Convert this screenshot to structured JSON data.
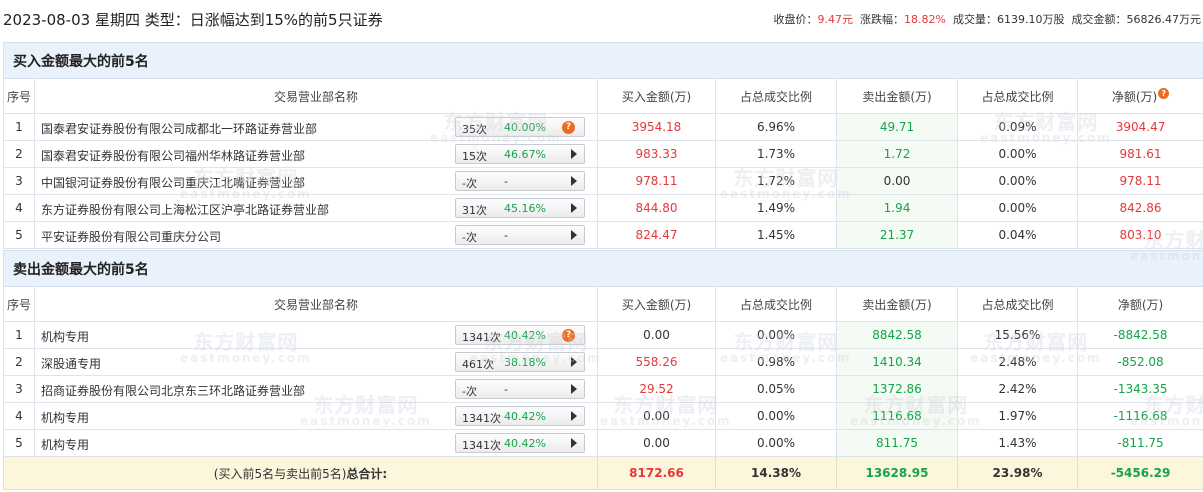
{
  "header": {
    "title": "2023-08-03 星期四 类型：日涨幅达到15%的前5只证券",
    "close_label": "收盘价：",
    "close_value": "9.47",
    "close_unit": "元",
    "change_label": "涨跌幅：",
    "change_value": "18.82%",
    "volume_label": "成交量：",
    "volume_value": "6139.10万股",
    "amount_label": "成交金额：",
    "amount_value": "56826.47万元"
  },
  "columns": {
    "seq": "序号",
    "dept": "交易营业部名称",
    "buy_amt": "买入金额(万)",
    "buy_ratio": "占总成交比例",
    "sell_amt": "卖出金额(万)",
    "sell_ratio": "占总成交比例",
    "net": "净额(万)"
  },
  "buy_section": {
    "title": "买入金额最大的前5名",
    "rows": [
      {
        "seq": "1",
        "name": "国泰君安证券股份有限公司成都北一环路证券营业部",
        "times": "35次",
        "rate": "40.00%",
        "buy": "3954.18",
        "buy_ratio": "6.96%",
        "sell": "49.71",
        "sell_ratio": "0.09%",
        "net": "3904.47"
      },
      {
        "seq": "2",
        "name": "国泰君安证券股份有限公司福州华林路证券营业部",
        "times": "15次",
        "rate": "46.67%",
        "buy": "983.33",
        "buy_ratio": "1.73%",
        "sell": "1.72",
        "sell_ratio": "0.00%",
        "net": "981.61"
      },
      {
        "seq": "3",
        "name": "中国银河证券股份有限公司重庆江北嘴证券营业部",
        "times": "-次",
        "rate": "-",
        "buy": "978.11",
        "buy_ratio": "1.72%",
        "sell": "0.00",
        "sell_ratio": "0.00%",
        "net": "978.11"
      },
      {
        "seq": "4",
        "name": "东方证券股份有限公司上海松江区沪亭北路证券营业部",
        "times": "31次",
        "rate": "45.16%",
        "buy": "844.80",
        "buy_ratio": "1.49%",
        "sell": "1.94",
        "sell_ratio": "0.00%",
        "net": "842.86"
      },
      {
        "seq": "5",
        "name": "平安证券股份有限公司重庆分公司",
        "times": "-次",
        "rate": "-",
        "buy": "824.47",
        "buy_ratio": "1.45%",
        "sell": "21.37",
        "sell_ratio": "0.04%",
        "net": "803.10"
      }
    ]
  },
  "sell_section": {
    "title": "卖出金额最大的前5名",
    "rows": [
      {
        "seq": "1",
        "name": "机构专用",
        "times": "1341次",
        "rate": "40.42%",
        "buy": "0.00",
        "buy_ratio": "0.00%",
        "sell": "8842.58",
        "sell_ratio": "15.56%",
        "net": "-8842.58"
      },
      {
        "seq": "2",
        "name": "深股通专用",
        "times": "461次",
        "rate": "38.18%",
        "buy": "558.26",
        "buy_ratio": "0.98%",
        "sell": "1410.34",
        "sell_ratio": "2.48%",
        "net": "-852.08"
      },
      {
        "seq": "3",
        "name": "招商证券股份有限公司北京东三环北路证券营业部",
        "times": "-次",
        "rate": "-",
        "buy": "29.52",
        "buy_ratio": "0.05%",
        "sell": "1372.86",
        "sell_ratio": "2.42%",
        "net": "-1343.35"
      },
      {
        "seq": "4",
        "name": "机构专用",
        "times": "1341次",
        "rate": "40.42%",
        "buy": "0.00",
        "buy_ratio": "0.00%",
        "sell": "1116.68",
        "sell_ratio": "1.97%",
        "net": "-1116.68"
      },
      {
        "seq": "5",
        "name": "机构专用",
        "times": "1341次",
        "rate": "40.42%",
        "buy": "0.00",
        "buy_ratio": "0.00%",
        "sell": "811.75",
        "sell_ratio": "1.43%",
        "net": "-811.75"
      }
    ]
  },
  "total": {
    "label_prefix": "(买入前5名与卖出前5名)",
    "label_bold": "总合计:",
    "buy": "8172.66",
    "buy_ratio": "14.38%",
    "sell": "13628.95",
    "sell_ratio": "23.98%",
    "net": "-5456.29"
  },
  "watermark": {
    "cn": "东方财富网",
    "en": "eastmoney.com"
  },
  "colors": {
    "red": "#e4393c",
    "green": "#16a34a",
    "section_bg": "#e9f1fb",
    "total_bg": "#fbf6dc"
  },
  "icons": {
    "info_badge": "question-icon",
    "expand": "triangle-right-icon"
  }
}
